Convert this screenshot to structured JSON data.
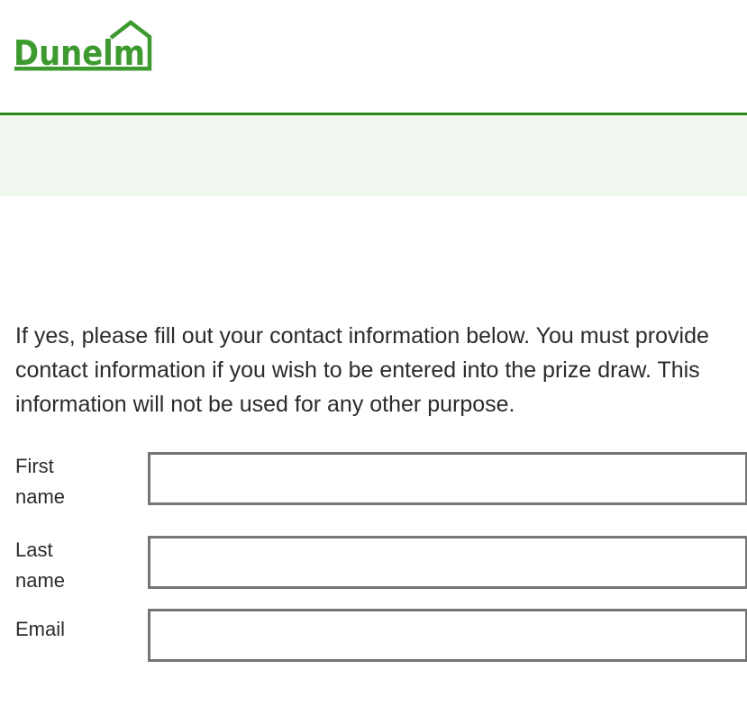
{
  "brand": {
    "logo_text": "Dunelm",
    "logo_color": "#3d9a2f",
    "accent_line_color": "#2f8a1c",
    "band_color": "#f1f8ef"
  },
  "intro_text": "If yes, please fill out your contact information below. You must provide contact information if you wish to be entered into the prize draw. This information will not be used for any other purpose.",
  "form": {
    "first_name": {
      "label_line1": "First",
      "label_line2": "name",
      "value": ""
    },
    "last_name": {
      "label_line1": "Last",
      "label_line2": "name",
      "value": ""
    },
    "email": {
      "label": "Email",
      "value": ""
    }
  }
}
